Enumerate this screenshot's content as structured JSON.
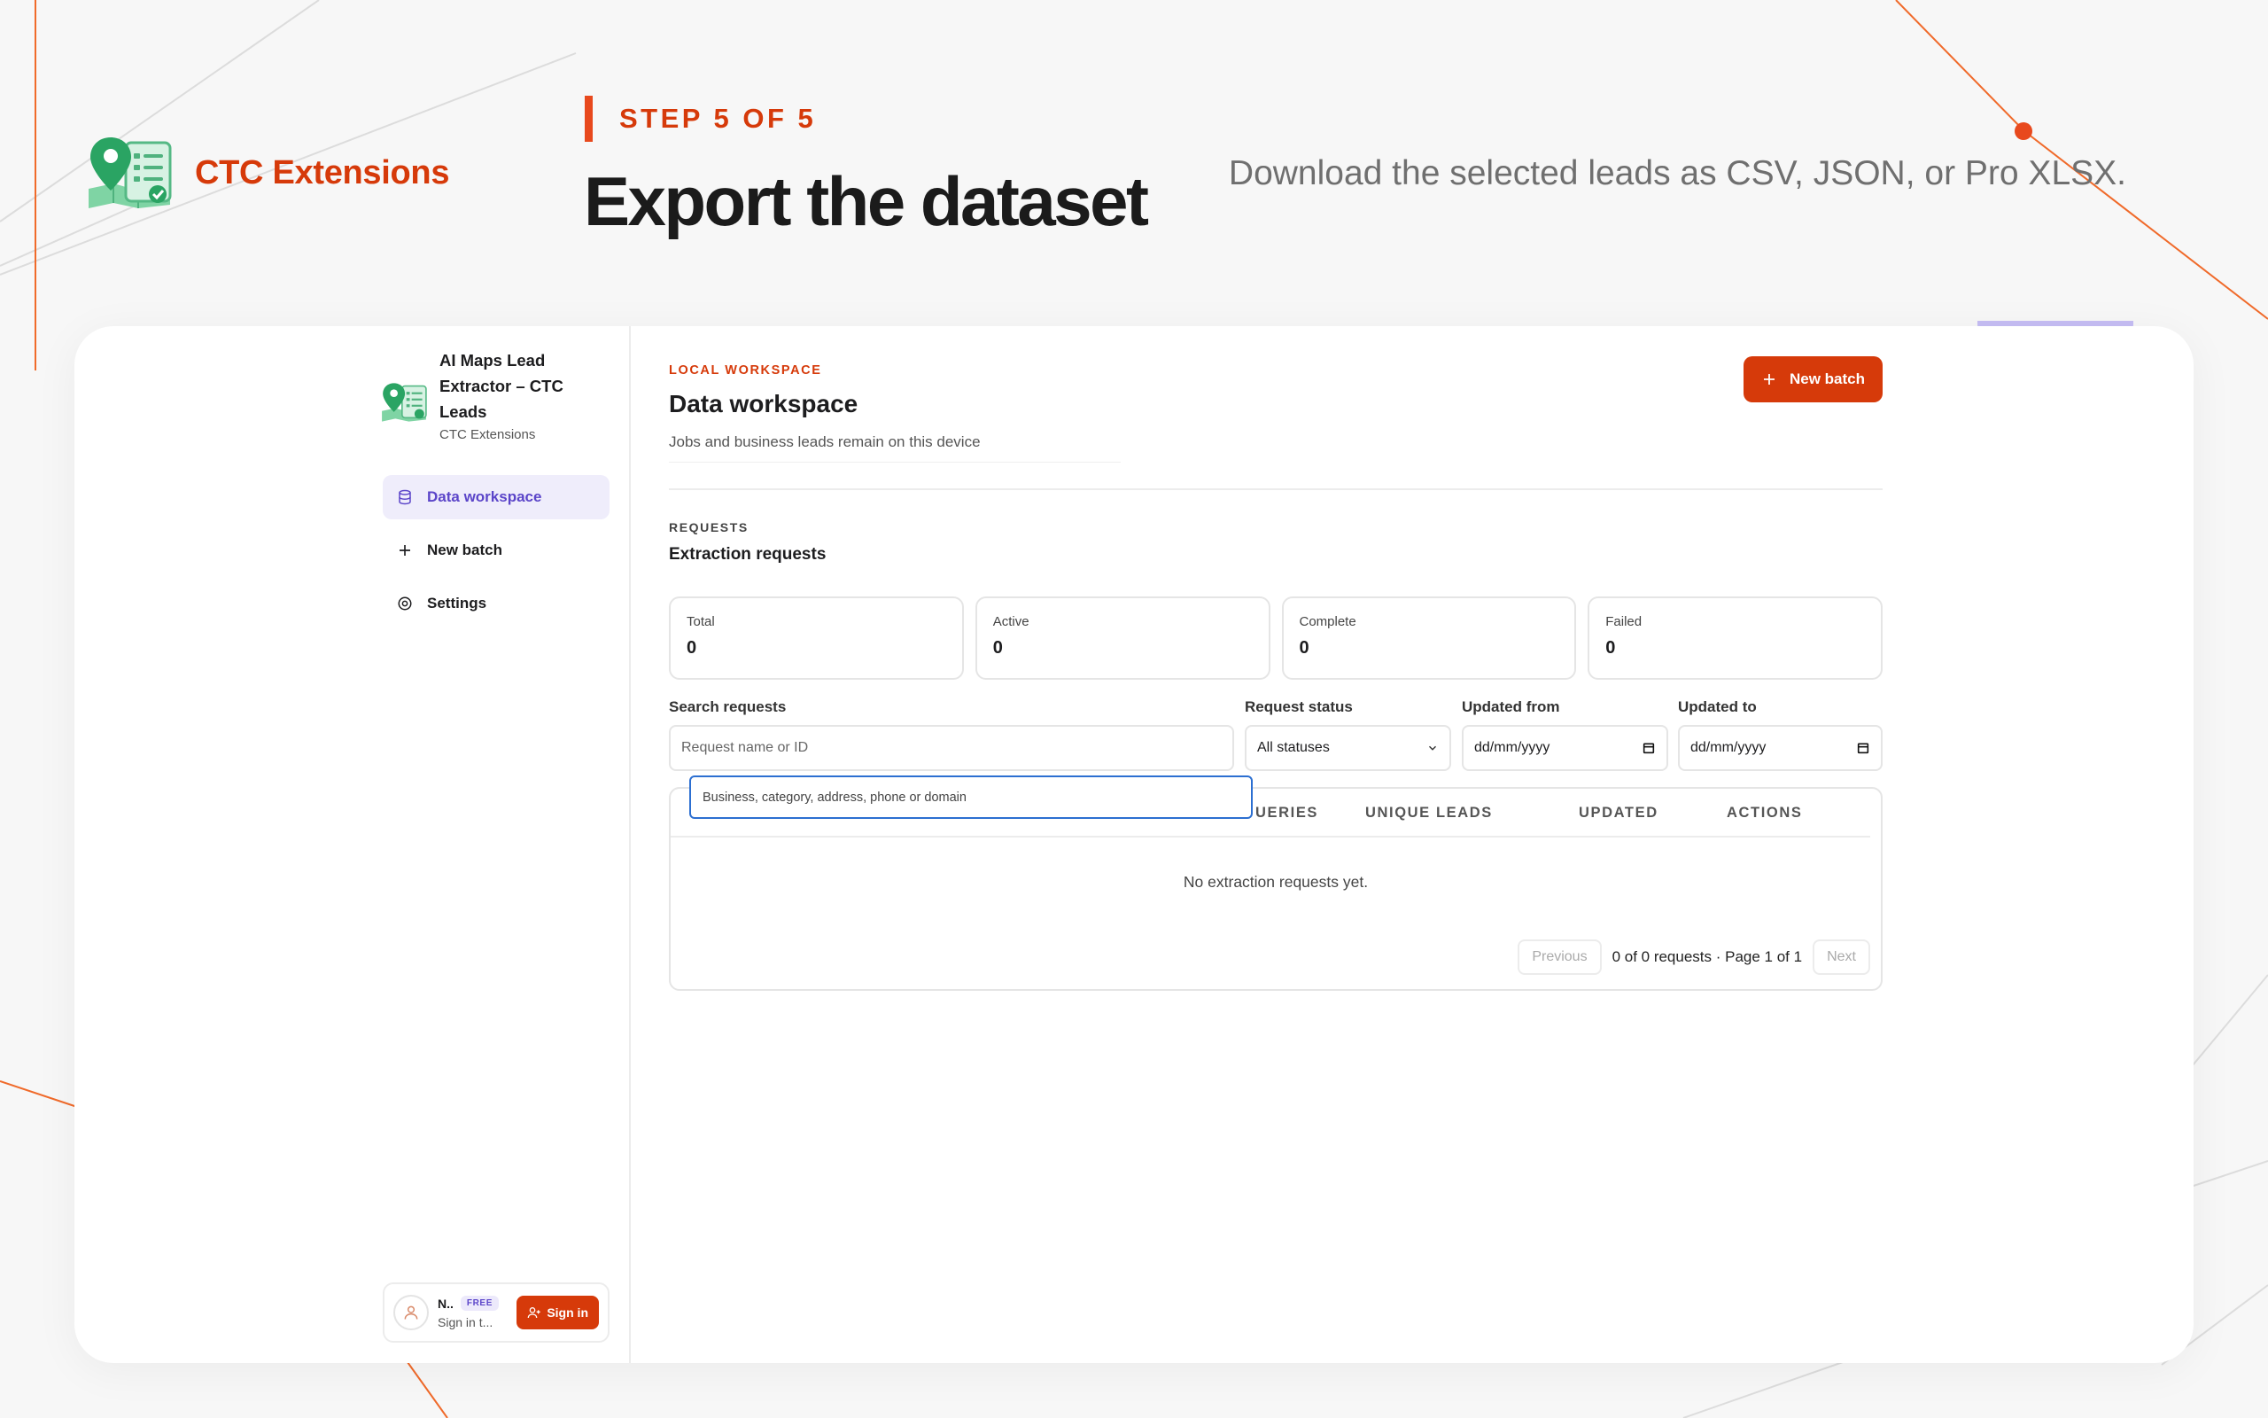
{
  "brand": {
    "name": "CTC Extensions",
    "icon": "map-pin-checklist-icon"
  },
  "hero": {
    "step": "STEP 5 OF 5",
    "title": "Export the dataset",
    "description": "Download the selected leads as CSV, JSON, or Pro XLSX."
  },
  "colors": {
    "accent": "#d63a0a",
    "purple": "#5b45c9",
    "background": "#f7f7f7"
  },
  "sidebar": {
    "app_title": "AI Maps Lead Extractor – CTC Leads",
    "app_subtitle": "CTC Extensions",
    "nav": [
      {
        "label": "Data workspace",
        "icon": "database-icon",
        "active": true
      },
      {
        "label": "New batch",
        "icon": "plus-icon",
        "active": false
      },
      {
        "label": "Settings",
        "icon": "gear-icon",
        "active": false
      }
    ],
    "user": {
      "name": "N..",
      "badge": "FREE",
      "subtitle": "Sign in t...",
      "signin_label": "Sign in"
    }
  },
  "main": {
    "eyebrow": "LOCAL WORKSPACE",
    "title": "Data workspace",
    "subtitle": "Jobs and business leads remain on this device",
    "new_batch_label": "New batch",
    "section_eyebrow": "REQUESTS",
    "section_title": "Extraction requests",
    "stats": [
      {
        "label": "Total",
        "value": "0"
      },
      {
        "label": "Active",
        "value": "0"
      },
      {
        "label": "Complete",
        "value": "0"
      },
      {
        "label": "Failed",
        "value": "0"
      }
    ],
    "filters": {
      "search_label": "Search requests",
      "search_placeholder": "Request name or ID",
      "status_label": "Request status",
      "status_value": "All statuses",
      "from_label": "Updated from",
      "from_value": "dd/mm/yyyy",
      "to_label": "Updated to",
      "to_value": "dd/mm/yyyy"
    },
    "autocomplete": "Business, category, address, phone or domain",
    "table": {
      "columns": [
        "UERIES",
        "UNIQUE LEADS",
        "UPDATED",
        "ACTIONS"
      ],
      "empty_text": "No extraction requests yet.",
      "prev_label": "Previous",
      "page_info": "0 of 0 requests · Page 1 of 1",
      "next_label": "Next"
    }
  }
}
